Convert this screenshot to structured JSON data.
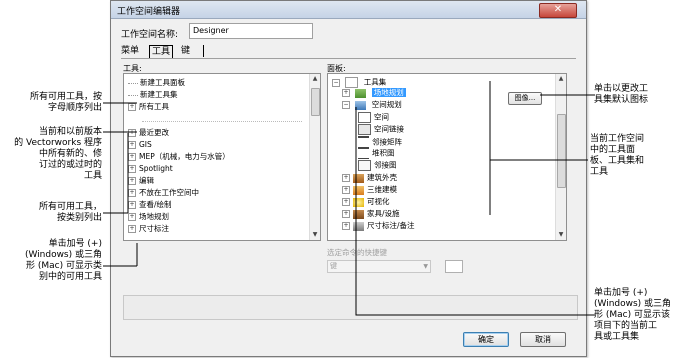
{
  "dialog": {
    "title": "工作空间编辑器",
    "close_glyph": "✕",
    "workspace_name_label": "工作空间名称:",
    "workspace_name_value": "Designer",
    "tabs": [
      "菜单",
      "工具",
      "键"
    ],
    "tools_label": "工具:",
    "palettes_label": "面板:",
    "tools_list": [
      {
        "pm": "",
        "label": "新建工具面板"
      },
      {
        "pm": "",
        "label": "新建工具集"
      },
      {
        "pm": "+",
        "label": "所有工具"
      },
      {
        "pm": "",
        "label": ""
      },
      {
        "pm": "+",
        "label": "最近更改"
      },
      {
        "pm": "+",
        "label": "GIS"
      },
      {
        "pm": "+",
        "label": "MEP（机械，电力与水管）"
      },
      {
        "pm": "+",
        "label": "Spotlight"
      },
      {
        "pm": "+",
        "label": "编辑"
      },
      {
        "pm": "+",
        "label": "不放在工作空间中"
      },
      {
        "pm": "+",
        "label": "查看/绘制"
      },
      {
        "pm": "+",
        "label": "场地规划"
      },
      {
        "pm": "+",
        "label": "尺寸标注"
      }
    ],
    "palette_tree": {
      "root": "工具集",
      "selected": "场地规划",
      "group": "空间规划",
      "children": [
        "空间",
        "空间链接",
        "邻接矩阵",
        "堆积图",
        "邻接图"
      ],
      "others": [
        "建筑外壳",
        "三维建模",
        "可视化",
        "家具/设施",
        "尺寸标注/备注"
      ]
    },
    "icon_button": "图像...",
    "shortcut_label": "选定命令的快捷键",
    "shortcut_value": "键",
    "ok_button": "确定",
    "cancel_button": "取消"
  },
  "annotations": {
    "left_1": [
      "所有可用工具，按",
      "字母顺序列出"
    ],
    "left_2": [
      "当前和以前版本",
      "的 Vectorworks 程序",
      "中所有新的、修",
      "订过的或过时的",
      "工具"
    ],
    "left_3": [
      "所有可用工具，",
      "按类别列出"
    ],
    "left_4": [
      "单击加号 (+)",
      "(Windows) 或三角",
      "形 (Mac) 可显示类",
      "别中的可用工具"
    ],
    "right_1": [
      "单击以更改工",
      "具集默认图标"
    ],
    "right_2": [
      "当前工作空间",
      "中的工具面",
      "板、工具集和",
      "工具"
    ],
    "right_3": [
      "单击加号 (+)",
      "(Windows) 或三角",
      "形 (Mac) 可显示该",
      "项目下的当前工",
      "具或工具集"
    ]
  }
}
